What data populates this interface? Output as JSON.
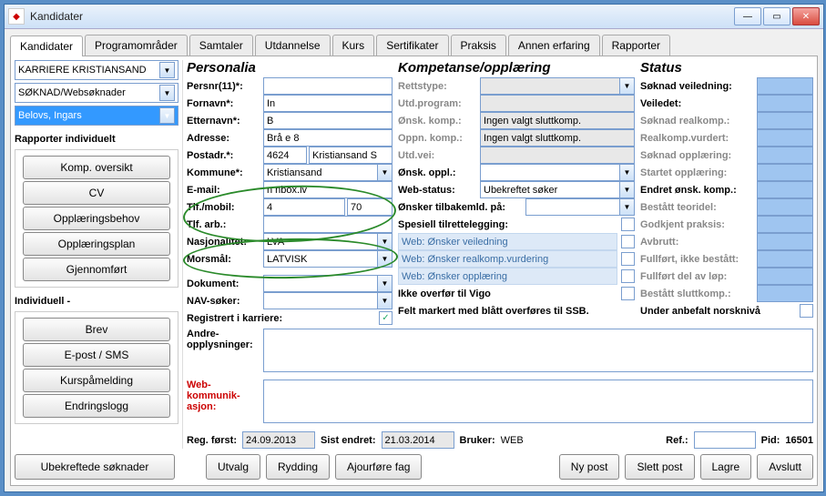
{
  "window": {
    "title": "Kandidater"
  },
  "winbuttons": {
    "min": "—",
    "max": "▭",
    "close": "✕"
  },
  "tabs": [
    "Kandidater",
    "Programområder",
    "Samtaler",
    "Utdannelse",
    "Kurs",
    "Sertifikater",
    "Praksis",
    "Annen erfaring",
    "Rapporter"
  ],
  "left": {
    "combo1": "KARRIERE KRISTIANSAND",
    "combo2": "SØKNAD/Websøknader",
    "combo3": "Belovs, Ingars",
    "report_label": "Rapporter individuelt",
    "buttons1": [
      "Komp. oversikt",
      "CV",
      "Opplæringsbehov",
      "Opplæringsplan",
      "Gjennomført"
    ],
    "indiv_label": "Individuell -",
    "buttons2": [
      "Brev",
      "E-post / SMS",
      "Kurspåmelding",
      "Endringslogg"
    ],
    "ubekreftede": "Ubekreftede søknader"
  },
  "personalia": {
    "header": "Personalia",
    "persnr_lbl": "Persnr(11)*:",
    "persnr": "",
    "fornavn_lbl": "Fornavn*:",
    "fornavn": "In",
    "etternavn_lbl": "Etternavn*:",
    "etternavn": "B",
    "adresse_lbl": "Adresse:",
    "adresse": "Brå            e 8",
    "postadr_lbl": "Postadr.*:",
    "postnr": "4624",
    "poststed": "Kristiansand S",
    "kommune_lbl": "Kommune*:",
    "kommune": "Kristiansand",
    "email_lbl": "E-mail:",
    "email": "n        nbox.lv",
    "tlf_lbl": "Tlf./mobil:",
    "tlf1": "4",
    "tlf2": "70",
    "tlfarb_lbl": "Tlf. arb.:",
    "tlfarb": "",
    "nasj_lbl": "Nasjonalitet:",
    "nasj": "LVA",
    "morsmal_lbl": "Morsmål:",
    "morsmal": "LATVISK",
    "dokument_lbl": "Dokument:",
    "dokument": "",
    "nav_lbl": "NAV-søker:",
    "nav": "",
    "reg_lbl": "Registrert i karriere:"
  },
  "kompetanse": {
    "header": "Kompetanse/opplæring",
    "retts_lbl": "Rettstype:",
    "utdprog_lbl": "Utd.program:",
    "onskkomp_lbl": "Ønsk. komp.:",
    "onskkomp": "Ingen valgt sluttkomp.",
    "oppnkomp_lbl": "Oppn. komp.:",
    "oppnkomp": "Ingen valgt sluttkomp.",
    "utdvei_lbl": "Utd.vei:",
    "onskoppl_lbl": "Ønsk. oppl.:",
    "webstatus_lbl": "Web-status:",
    "webstatus": "Ubekreftet søker",
    "onsktilbake_lbl": "Ønsker tilbakemld. på:",
    "spesiell_lbl": "Spesiell tilrettelegging:",
    "web1": "Web: Ønsker veiledning",
    "web2": "Web: Ønsker realkomp.vurdering",
    "web3": "Web: Ønsker opplæring",
    "ikkeover_lbl": "Ikke overfør til Vigo",
    "feltmark": "Felt markert med blått overføres til SSB."
  },
  "status": {
    "header": "Status",
    "rows": [
      "Søknad veiledning:",
      "Veiledet:",
      "Søknad realkomp.:",
      "Realkomp.vurdert:",
      "Søknad opplæring:",
      "Startet opplæring:",
      "Endret ønsk. komp.:",
      "Bestått teoridel:",
      "Godkjent praksis:",
      "Avbrutt:",
      "Fullført, ikke bestått:",
      "Fullført del av løp:",
      "Bestått sluttkomp.:"
    ],
    "norsk_lbl": "Under anbefalt norsknivå"
  },
  "texts": {
    "andre_lbl1": "Andre-",
    "andre_lbl2": "opplysninger:",
    "web_lbl1": "Web-",
    "web_lbl2": "kommunik-",
    "web_lbl3": "asjon:"
  },
  "regrow": {
    "regforst_lbl": "Reg. først:",
    "regforst": "24.09.2013",
    "sistendret_lbl": "Sist endret:",
    "sistendret": "21.03.2014",
    "bruker_lbl": "Bruker:",
    "bruker": "WEB",
    "ref_lbl": "Ref.:",
    "pid_lbl": "Pid:",
    "pid": "16501"
  },
  "footer": {
    "utvalg": "Utvalg",
    "rydding": "Rydding",
    "ajour": "Ajourføre fag",
    "nypost": "Ny post",
    "slett": "Slett post",
    "lagre": "Lagre",
    "avslutt": "Avslutt"
  }
}
